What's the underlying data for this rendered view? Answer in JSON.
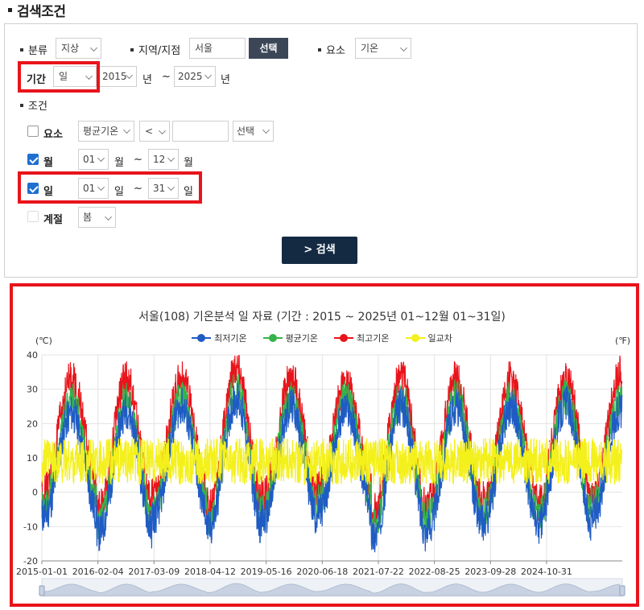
{
  "heading": "검색조건",
  "filters": {
    "category_label": "분류",
    "category_value": "지상",
    "region_label": "지역/지점",
    "region_value": "서울",
    "region_button": "선택",
    "element_label": "요소",
    "element_value": "기온",
    "period_label": "기간",
    "period_value": "일",
    "year_from": "2015",
    "year_unit": "년",
    "tilde": "~",
    "year_to": "2025",
    "condition_label": "조건",
    "cond_element": {
      "label": "요소",
      "checked": false,
      "select": "평균기온",
      "operator": "<",
      "value": "",
      "button": "선택"
    },
    "cond_month": {
      "label": "월",
      "checked": true,
      "from": "01",
      "to": "12",
      "unit": "월"
    },
    "cond_day": {
      "label": "일",
      "checked": true,
      "from": "01",
      "to": "31",
      "unit": "일"
    },
    "cond_season": {
      "label": "계절",
      "checked": false,
      "value": "봄"
    },
    "search_button": "> 검색"
  },
  "chart_data": {
    "type": "line",
    "title": "서울(108) 기온분석 일 자료 (기간 : 2015 ~ 2025년  01~12월 01~31일)",
    "y_left_unit": "(℃)",
    "y_right_unit": "(℉)",
    "ylim": [
      -20,
      40
    ],
    "yticks": [
      -20,
      -10,
      0,
      10,
      20,
      30,
      40
    ],
    "xticks": [
      "2015-01-01",
      "2016-02-04",
      "2017-03-09",
      "2018-04-12",
      "2019-05-16",
      "2020-06-18",
      "2021-07-22",
      "2022-08-25",
      "2023-09-28",
      "2024-10-31"
    ],
    "legend_position": "top-center",
    "grid": true,
    "series": [
      {
        "name": "최저기온",
        "color": "#1f5bc4",
        "annual_min": [
          -13,
          -18,
          -13,
          -17,
          -14,
          -12,
          -19,
          -16,
          -15,
          -16,
          -12
        ],
        "annual_max": [
          26,
          27,
          28,
          30,
          28,
          27,
          28,
          28,
          28,
          29,
          27
        ]
      },
      {
        "name": "평균기온",
        "color": "#35b34a",
        "annual_min": [
          -10,
          -15,
          -10,
          -14,
          -11,
          -9,
          -16,
          -13,
          -12,
          -13,
          -9
        ],
        "annual_max": [
          30,
          30,
          30,
          33,
          30,
          30,
          31,
          31,
          30,
          31,
          30
        ]
      },
      {
        "name": "최고기온",
        "color": "#e8141b",
        "annual_min": [
          -6,
          -11,
          -6,
          -10,
          -7,
          -5,
          -12,
          -9,
          -8,
          -9,
          -6
        ],
        "annual_max": [
          36,
          36,
          36,
          39,
          36,
          35,
          37,
          36,
          36,
          36,
          38
        ]
      },
      {
        "name": "일교차",
        "color": "#f4f01c",
        "min": 1,
        "max": 16,
        "mean": 9
      }
    ]
  }
}
